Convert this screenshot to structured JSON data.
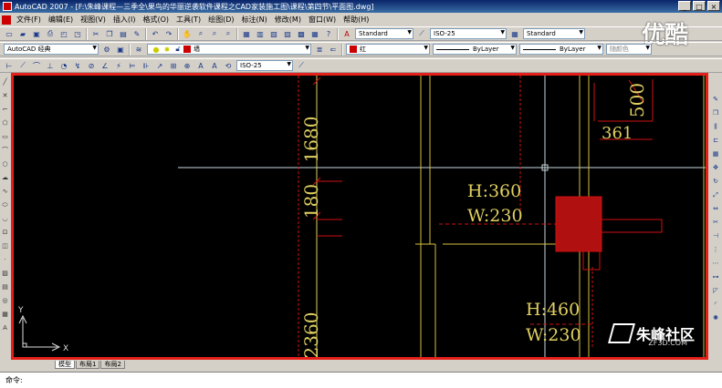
{
  "window": {
    "title": "AutoCAD 2007 - [F:\\朱峰课程—三季全\\果鸟的华丽逆袭软件课程之CAD家装施工图\\课程\\第四节\\平面图.dwg]",
    "buttons": [
      "_",
      "□",
      "×"
    ]
  },
  "menu": {
    "items": [
      "文件(F)",
      "编辑(E)",
      "视图(V)",
      "插入(I)",
      "格式(O)",
      "工具(T)",
      "绘图(D)",
      "标注(N)",
      "修改(M)",
      "窗口(W)",
      "帮助(H)"
    ]
  },
  "toolbar": {
    "text_style": "Standard",
    "dim_style": "ISO-25",
    "table_style": "Standard",
    "workspace": "AutoCAD 经典",
    "layer": "墙",
    "color": "红",
    "linetype": "ByLayer",
    "lineweight": "ByLayer",
    "plotstyle": "随颜色",
    "dim_style_2": "ISO-25",
    "colors": {
      "layer_swatch": "#cc0000"
    }
  },
  "watermark": {
    "text": "优酷"
  },
  "canvas": {
    "colors": {
      "dim": "#e0d060",
      "wall": "#d4c040",
      "red": "#d01010",
      "cross": "#c8d8e0"
    },
    "dimensions": {
      "d1680": "1680",
      "d180": "180",
      "d2360": "2360",
      "d500": "500",
      "d361": "361",
      "h360": "H:360",
      "w230a": "W:230",
      "h460": "H:460",
      "w230b": "W:230"
    },
    "ucs": {
      "x": "X",
      "y": "Y"
    }
  },
  "tabs": [
    "模型",
    "布局1",
    "布局2"
  ],
  "command": {
    "prompt": "命令:"
  },
  "brand": {
    "name": "朱峰社区",
    "url": "ZF3D.COM"
  }
}
